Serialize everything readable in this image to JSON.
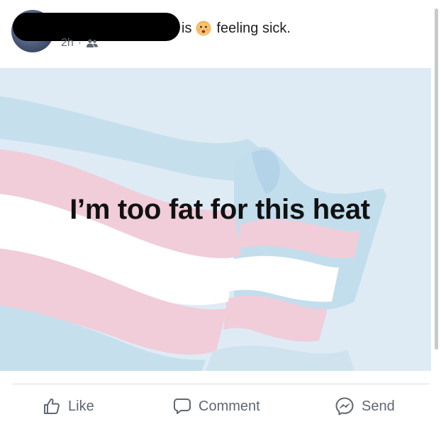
{
  "header": {
    "status_prefix": "is",
    "feeling_text": "feeling sick.",
    "timestamp": "2h",
    "separator": "·",
    "audience_icon": "friends-icon",
    "feeling_icon": "sick-face-emoji"
  },
  "post": {
    "text": "I’m too fat for this heat",
    "background_colors": {
      "sky": "#deebf5",
      "blue": "#bfdcec",
      "pink": "#f0cdd8",
      "white": "#ffffff"
    }
  },
  "actions": {
    "like_label": "Like",
    "comment_label": "Comment",
    "send_label": "Send"
  }
}
